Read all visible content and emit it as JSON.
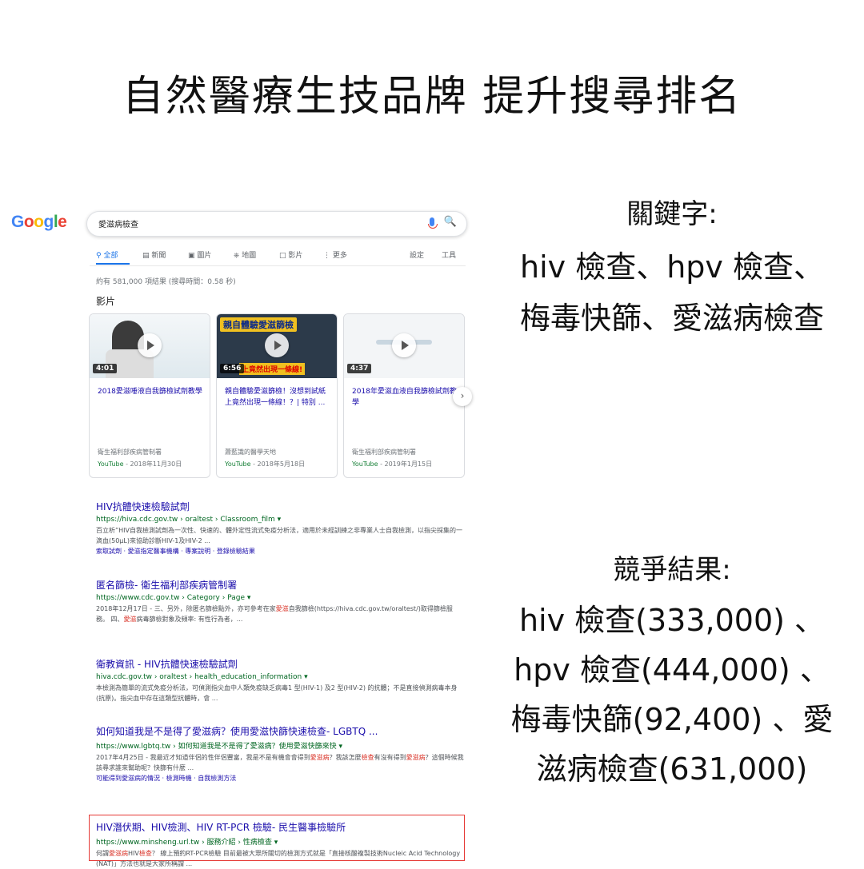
{
  "headline": "自然醫療生技品牌 提升搜尋排名",
  "keywords": {
    "title": "關鍵字:",
    "lines": [
      "hiv 檢查、hpv 檢查、",
      "梅毒快篩、愛滋病檢查"
    ]
  },
  "competition": {
    "title": "競爭結果:",
    "lines": [
      "hiv 檢查(333,000) 、",
      "hpv 檢查(444,000) 、",
      "梅毒快篩(92,400) 、愛",
      "滋病檢查(631,000)"
    ]
  },
  "google": {
    "logo": [
      "G",
      "o",
      "o",
      "g",
      "l",
      "e"
    ],
    "query": "愛滋病檢查",
    "tabs": [
      "全部",
      "新聞",
      "圖片",
      "地圖",
      "影片",
      "更多",
      "設定",
      "工具"
    ],
    "stats": "約有 581,000 項結果 (搜尋時間：0.58 秒)",
    "videos_heading": "影片",
    "videos": [
      {
        "duration": "4:01",
        "title": "2018愛滋唾液自我篩檢試劑教學",
        "source": "衛生福利部疾病管制署",
        "platform": "YouTube",
        "date": " - 2018年11月30日"
      },
      {
        "duration": "6:56",
        "banner": "親自體驗愛滋篩檢",
        "banner2": "上竟然出現一條線!",
        "title": "親自體驗愛滋篩檢！沒想到試紙上竟然出現一條線！？| 特別 ...",
        "source": "蕭藍識的醫學天地",
        "platform": "YouTube",
        "date": " - 2018年5月18日"
      },
      {
        "duration": "4:37",
        "title": "2018年愛滋血液自我篩檢試劑教學",
        "source": "衛生福利部疾病管制署",
        "platform": "YouTube",
        "date": " - 2019年1月15日"
      }
    ],
    "results": [
      {
        "title": "HIV抗體快速檢驗試劑",
        "url": "https://hiva.cdc.gov.tw › oraltest › Classroom_film ▾",
        "snippet": "百立析”HIV自我檢測試劑為一次性、快速的、體外定性流式免疫分析法，適用於未經訓練之非專業人士自我檢測，以指尖採集的一滴血(50µL)來協助診斷HIV-1及HIV-2 ...",
        "links": "索取試劑 · 愛滋指定醫事機構 · 專案說明 · 登錄檢驗結果"
      },
      {
        "title": "匿名篩檢- 衛生福利部疾病管制署",
        "url": "https://www.cdc.gov.tw › Category › Page ▾",
        "snippet_a": "2018年12月17日 - 三、另外，除匿名篩檢點外，亦可參考在家",
        "snippet_hl1": "愛滋",
        "snippet_b": "自我篩檢(https://hiva.cdc.gov.tw/oraltest/)取得篩檢服務。 四、",
        "snippet_hl2": "愛滋",
        "snippet_c": "病毒篩檢對象及頻率: 有性行為者，..."
      },
      {
        "title": "衛教資訊 - HIV抗體快速檢驗試劑",
        "url": "hiva.cdc.gov.tw › oraltest › health_education_information ▾",
        "snippet": "本檢測為簡單的流式免疫分析法，可偵測指尖血中人類免疫缺乏病毒1 型(HIV-1) 及2 型(HIV-2) 的抗體；不是直接偵測病毒本身(抗原)。指尖血中存在這類型抗體時，會 ..."
      },
      {
        "title": "如何知道我是不是得了愛滋病？使用愛滋快篩快速檢查- LGBTQ ...",
        "url": "https://www.lgbtq.tw › 如何知道我是不是得了愛滋病？使用愛滋快篩來快 ▾",
        "snippet_a": "2017年4月25日 - 我最近才知道伴侶的性伴侶豐富，我是不是有機會會得到",
        "snippet_hl1": "愛滋病",
        "snippet_b": "？我該怎麼",
        "snippet_hl2": "檢查",
        "snippet_c": "有沒有得到",
        "snippet_hl3": "愛滋病",
        "snippet_d": "？這個時候我該尋求誰來幫助呢？快篩有什麼 ...",
        "links": "可能得到愛滋病的情況 · 檢測時機 · 自我檢測方法"
      },
      {
        "title": "HIV潛伏期、HIV檢測、HIV RT-PCR 檢驗- 民生醫事檢驗所",
        "url": "https://www.minsheng.url.tw › 服務介紹 › 性病檢查 ▾",
        "snippet_a": "何謂",
        "snippet_hl1": "愛滋病",
        "snippet_b": "HIV",
        "snippet_hl2": "檢查",
        "snippet_c": "？ 線上預約RT-PCR檢驗 目前最被大眾所關切的檢測方式就是「直接核酸複製技術Nucleic Acid Technology (NAT)」方法也就是大家所稱謂 ..."
      }
    ]
  }
}
